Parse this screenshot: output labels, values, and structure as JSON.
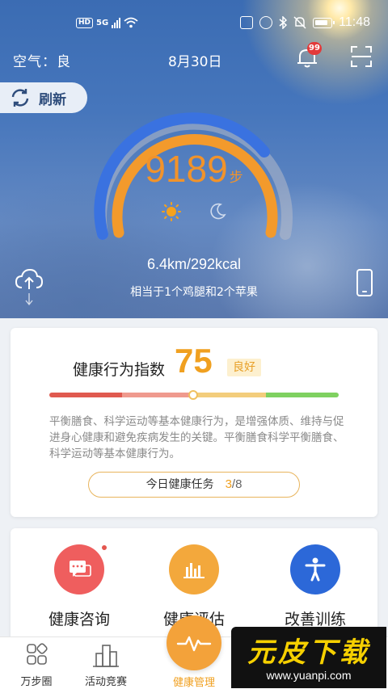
{
  "status_bar": {
    "hd": "HD",
    "net": "5G",
    "time": "11:48"
  },
  "header": {
    "air_quality": "空气：良",
    "date": "8月30日",
    "notification_badge": "99",
    "refresh_label": "刷新"
  },
  "steps": {
    "count": "9189",
    "unit": "步",
    "distance_calories": "6.4km/292kcal",
    "equivalent": "相当于1个鸡腿和2个苹果"
  },
  "health_index": {
    "title": "健康行为指数",
    "score": "75",
    "level": "良好",
    "description": "平衡膳食、科学运动等基本健康行为，是增强体质、维持与促进身心健康和避免疾病发生的关键。平衡膳食科学平衡膳食、科学运动等基本健康行为。",
    "task_label": "今日健康任务",
    "task_done": "3",
    "task_total": "/8",
    "colors": {
      "bad": "#e05a4f",
      "poor": "#ef9a8e",
      "fair": "#f3cd7c",
      "good": "#7fd160"
    }
  },
  "services": [
    {
      "label": "健康咨询",
      "icon": "chat-icon",
      "color": "#ef5e5e"
    },
    {
      "label": "健康评估",
      "icon": "bar-chart-icon",
      "color": "#f3a83c"
    },
    {
      "label": "改善训练",
      "icon": "person-icon",
      "color": "#2c68d8"
    }
  ],
  "bottom_nav": [
    {
      "label": "万步圈",
      "icon": "grid-icon"
    },
    {
      "label": "活动竞赛",
      "icon": "buildings-icon"
    },
    {
      "label": "健康管理",
      "icon": "heartbeat-icon",
      "active": true
    }
  ],
  "watermark": {
    "brand": "元皮下载",
    "url": "www.yuanpi.com"
  },
  "colors": {
    "accent": "#f0a020",
    "gauge_blue": "#3a72e0",
    "gauge_orange": "#f39a2c"
  }
}
